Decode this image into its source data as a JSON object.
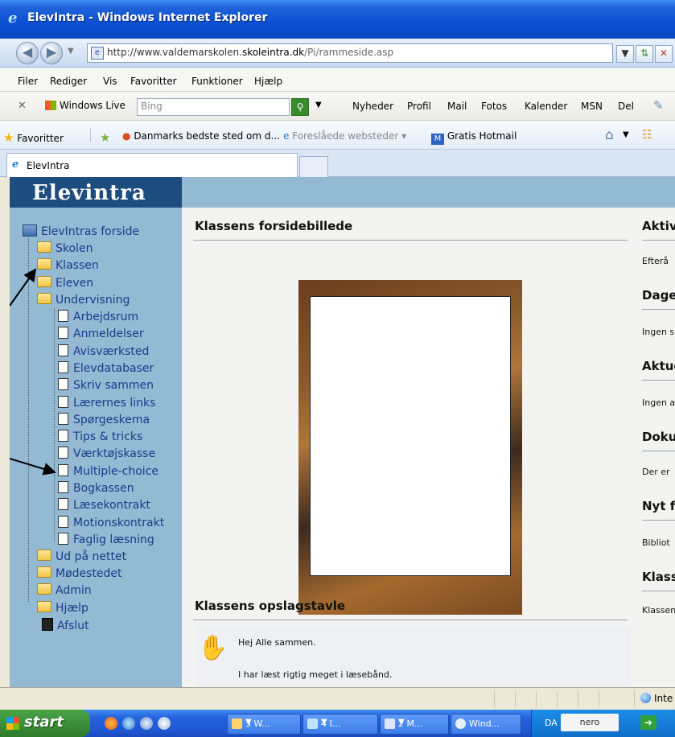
{
  "window": {
    "title": "ElevIntra - Windows Internet Explorer"
  },
  "address": {
    "url_prefix": "http://www.valdemarskolen.",
    "url_domain": "skoleintra.dk",
    "url_path": "/Pi/rammeside.asp"
  },
  "menu": [
    "Filer",
    "Rediger",
    "Vis",
    "Favoritter",
    "Funktioner",
    "Hjælp"
  ],
  "live_bar": {
    "brand": "Windows Live",
    "search_placeholder": "Bing",
    "links": [
      "Nyheder",
      "Profil",
      "Mail",
      "Fotos",
      "Kalender",
      "MSN",
      "Del"
    ]
  },
  "favorites_bar": {
    "favorites_label": "Favoritter",
    "items": [
      "Danmarks bedste sted om d...",
      "Foreslåede websteder ▾",
      "Gratis Hotmail"
    ]
  },
  "tab": {
    "label": "ElevIntra"
  },
  "site": {
    "logo": "Elevintra",
    "nav": {
      "home": "ElevIntras forside",
      "folders_top": [
        "Skolen",
        "Klassen",
        "Eleven",
        "Undervisning"
      ],
      "undervisning_items": [
        "Arbejdsrum",
        "Anmeldelser",
        "Avisværksted",
        "Elevdatabaser",
        "Skriv sammen",
        "Lærernes links",
        "Spørgeskema",
        "Tips & tricks",
        "Værktøjskasse",
        "Multiple-choice",
        "Bogkassen",
        "Læsekontrakt",
        "Motionskontrakt",
        "Faglig læsning"
      ],
      "folders_bottom": [
        "Ud på nettet",
        "Mødestedet",
        "Admin",
        "Hjælp"
      ],
      "exit": "Afslut"
    },
    "main": {
      "photo_title": "Klassens forsidebillede",
      "board_title": "Klassens opslagstavle",
      "board_lines": [
        "Hej Alle sammen.",
        "I har læst rigtig meget i læsebånd."
      ]
    },
    "right_col": [
      {
        "title": "Aktiv",
        "text": "Efterå"
      },
      {
        "title": "Dage",
        "text": "Ingen s"
      },
      {
        "title": "Aktue",
        "text": "Ingen a"
      },
      {
        "title": "Doku",
        "text": "Der er"
      },
      {
        "title": "Nyt f",
        "text": "Bibliot"
      },
      {
        "title": "Klasse",
        "text": "Klassen"
      }
    ]
  },
  "status": {
    "zone": "Inte"
  },
  "taskbar": {
    "start": "start",
    "tasks": [
      "3 W...",
      "4 I...",
      "2 M...",
      "Wind..."
    ],
    "lang": "DA",
    "nero": "nero"
  },
  "colors": {
    "sidebar": "#93b9d3",
    "logo_bg": "#1d4c7f",
    "nav_text": "#1d3a8c",
    "taskbar": "#2462dc"
  }
}
